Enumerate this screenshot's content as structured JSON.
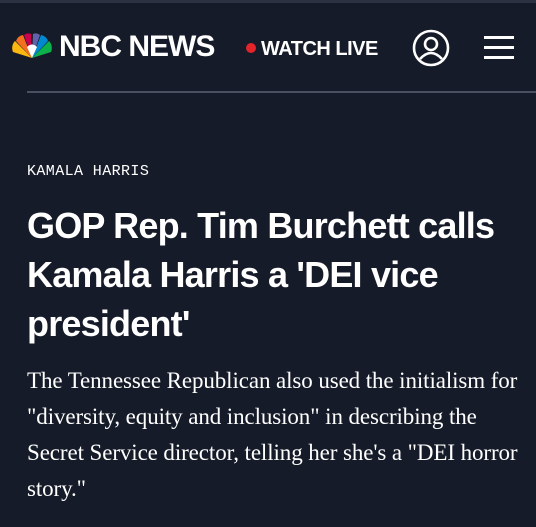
{
  "header": {
    "brand": "NBC NEWS",
    "watch_live": "WATCH LIVE",
    "account_icon": "account-icon",
    "menu_icon": "hamburger-menu-icon"
  },
  "article": {
    "eyebrow": "KAMALA HARRIS",
    "headline": "GOP Rep. Tim Burchett calls Kamala Harris a 'DEI vice president'",
    "dek": "The Tennessee Republican also used the initialism for \"diversity, equity and inclusion\" in describing the Secret Service director, telling her she's a \"DEI horror story.\""
  },
  "colors": {
    "background": "#161b29",
    "live_dot": "#e3242b",
    "divider": "#4a5060",
    "peacock": [
      "#fcb711",
      "#f37021",
      "#cc004c",
      "#6460aa",
      "#0089d0",
      "#0db14b"
    ]
  }
}
